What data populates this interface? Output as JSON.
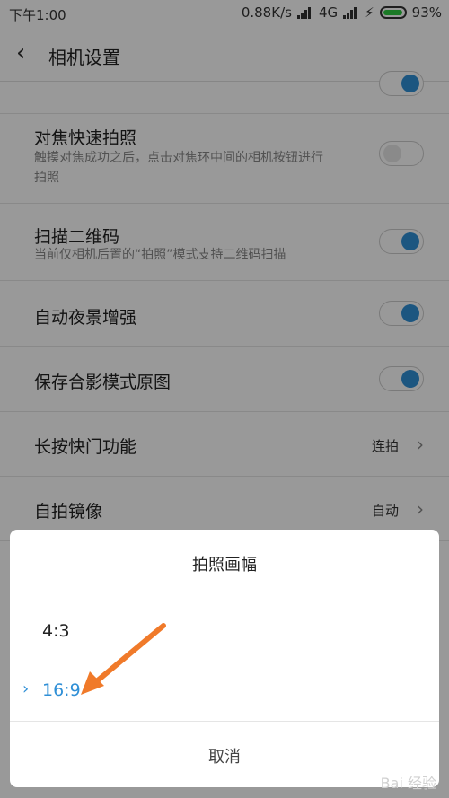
{
  "status": {
    "time": "下午1:00",
    "speed": "0.88K/s",
    "network": "4G",
    "battery": "93%"
  },
  "header": {
    "title": "相机设置",
    "back_icon": "‹"
  },
  "settings": [
    {
      "title": "对焦快速拍照",
      "subtitle": "触摸对焦成功之后，点击对焦环中间的相机按钮进行拍照",
      "toggle": false
    },
    {
      "title": "扫描二维码",
      "subtitle": "当前仅相机后置的“拍照”模式支持二维码扫描",
      "toggle": true
    },
    {
      "title": "自动夜景增强",
      "toggle": true
    },
    {
      "title": "保存合影模式原图",
      "toggle": true
    },
    {
      "title": "长按快门功能",
      "value": "连拍"
    },
    {
      "title": "自拍镜像",
      "value": "自动"
    }
  ],
  "dialog": {
    "title": "拍照画幅",
    "options": [
      {
        "label": "4:3",
        "selected": false
      },
      {
        "label": "16:9",
        "selected": true
      }
    ],
    "cancel": "取消"
  },
  "watermark": "Bai 经验",
  "colors": {
    "accent": "#2f8fd6",
    "arrow": "#f07a2a"
  }
}
